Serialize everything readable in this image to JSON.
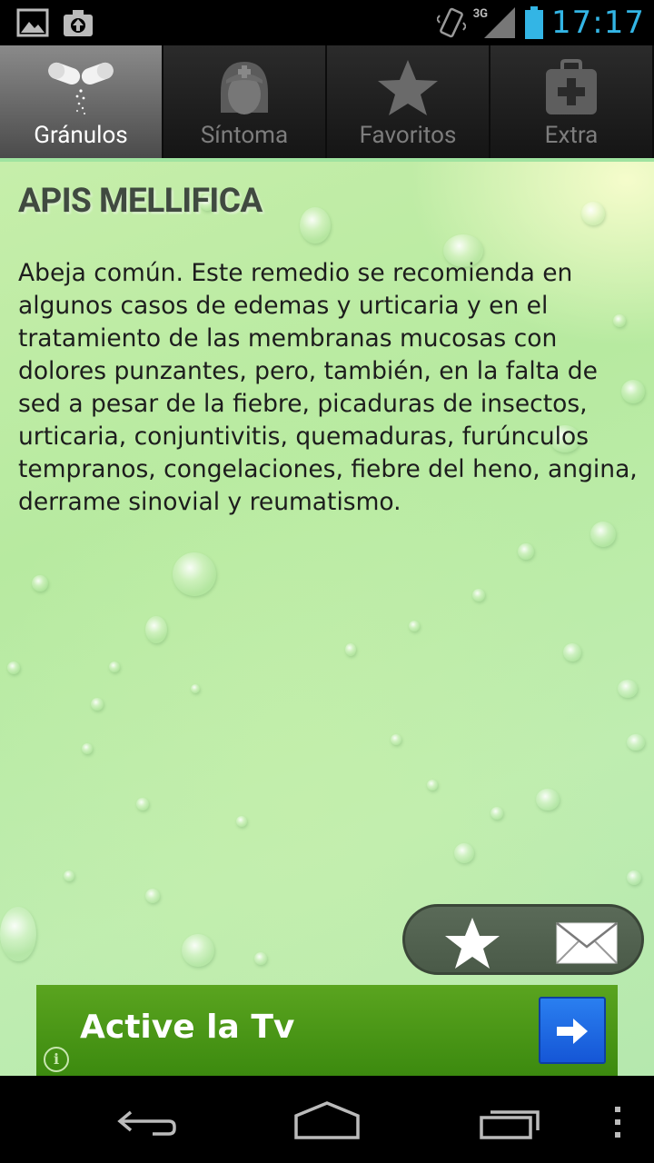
{
  "status_bar": {
    "time": "17:17",
    "network": "3G",
    "icons": [
      "image-notification-icon",
      "upload-notification-icon",
      "vibrate-icon",
      "signal-icon",
      "battery-icon"
    ]
  },
  "tabs": [
    {
      "label": "Gránulos",
      "icon": "pills-icon",
      "active": true
    },
    {
      "label": "Síntoma",
      "icon": "nurse-icon",
      "active": false
    },
    {
      "label": "Favoritos",
      "icon": "star-icon",
      "active": false
    },
    {
      "label": "Extra",
      "icon": "first-aid-kit-icon",
      "active": false
    }
  ],
  "remedy": {
    "title": "APIS MELLIFICA",
    "description": "Abeja común. Este remedio se recomienda en algunos casos de edemas y urticaria y en el tratamiento de las membranas mucosas con dolores punzantes, pero, también, en la falta de sed a pesar de la fiebre, picaduras de insectos, urticaria, conjuntivitis, quemaduras, furúnculos tempranos, congelaciones, fiebre del heno, angina, derrame sinovial y reumatismo."
  },
  "actions": {
    "favorite_icon": "star-icon",
    "share_icon": "mail-icon"
  },
  "ad": {
    "text": "Active la Tv",
    "info_glyph": "i",
    "button_icon": "arrow-right-icon"
  },
  "colors": {
    "clock": "#33b5e5",
    "tab_underline": "#9fe3a0",
    "ad_green": "#4c9a18",
    "ad_button_blue": "#1f6ae6"
  },
  "nav_bar": {
    "buttons": [
      "back-icon",
      "home-icon",
      "recent-apps-icon",
      "overflow-menu-icon"
    ]
  }
}
